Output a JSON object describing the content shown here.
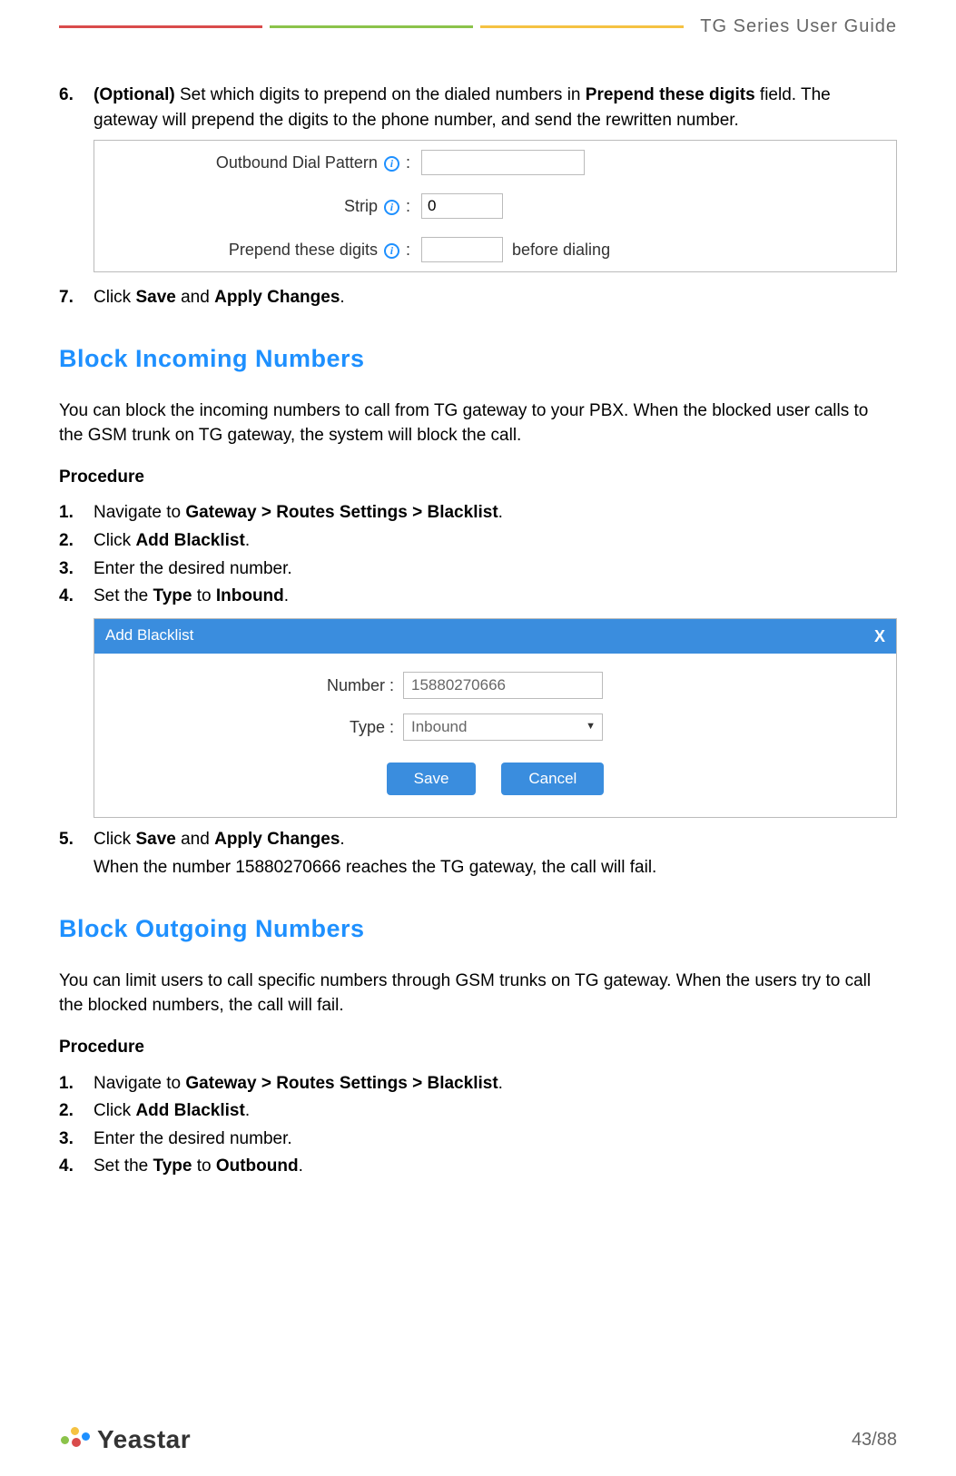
{
  "header": {
    "title": "TG  Series  User  Guide"
  },
  "step6": {
    "num": "6.",
    "optional": "(Optional)",
    "text_a": " Set which digits to prepend on the dialed numbers in ",
    "bold_b": "Prepend these digits",
    "text_c": " field. The gateway will prepend the digits to the phone number, and send the rewritten number."
  },
  "panel1": {
    "row1": {
      "label": "Outbound Dial Pattern",
      "colon": " :",
      "value": ""
    },
    "row2": {
      "label": "Strip",
      "colon": " :",
      "value": "0"
    },
    "row3": {
      "label": "Prepend these digits",
      "colon": " :",
      "value": "",
      "after": "before dialing"
    }
  },
  "step7": {
    "num": "7.",
    "text_a": "Click ",
    "bold_b": "Save",
    "text_c": " and ",
    "bold_d": "Apply Changes",
    "text_e": "."
  },
  "sec1": {
    "heading": "Block Incoming  Numbers",
    "intro": "You can block the incoming numbers to call from TG gateway to your PBX. When the blocked user calls to the GSM trunk on TG gateway, the system will block the call.",
    "procedure_label": "Procedure",
    "steps": {
      "s1": {
        "num": "1.",
        "a": "Navigate to ",
        "b": "Gateway > Routes Settings > Blacklist",
        "c": "."
      },
      "s2": {
        "num": "2.",
        "a": "Click ",
        "b": "Add Blacklist",
        "c": "."
      },
      "s3": {
        "num": "3.",
        "a": "Enter the desired number."
      },
      "s4": {
        "num": "4.",
        "a": "Set the ",
        "b": "Type",
        "c": " to ",
        "d": "Inbound",
        "e": "."
      }
    }
  },
  "dialog1": {
    "title": "Add Blacklist",
    "close": "X",
    "number_label": "Number :",
    "number_value": "15880270666",
    "type_label": "Type :",
    "type_value": "Inbound",
    "save": "Save",
    "cancel": "Cancel"
  },
  "step5": {
    "num": "5.",
    "a": "Click ",
    "b": "Save",
    "c": " and ",
    "d": "Apply Changes",
    "e": ".",
    "note": "When the number 15880270666 reaches the TG gateway, the call will fail."
  },
  "sec2": {
    "heading": "Block Outgoing Numbers",
    "intro": "You can limit users to call specific numbers through GSM trunks on TG gateway. When the users try to call the blocked numbers, the call will fail.",
    "procedure_label": "Procedure",
    "steps": {
      "s1": {
        "num": "1.",
        "a": "Navigate to ",
        "b": "Gateway > Routes Settings > Blacklist",
        "c": "."
      },
      "s2": {
        "num": "2.",
        "a": "Click ",
        "b": "Add Blacklist",
        "c": "."
      },
      "s3": {
        "num": "3.",
        "a": "Enter the desired number."
      },
      "s4": {
        "num": "4.",
        "a": "Set the ",
        "b": "Type",
        "c": " to ",
        "d": "Outbound",
        "e": "."
      }
    }
  },
  "info_i": "i",
  "footer": {
    "brand": "Yeastar",
    "page": "43/88"
  }
}
